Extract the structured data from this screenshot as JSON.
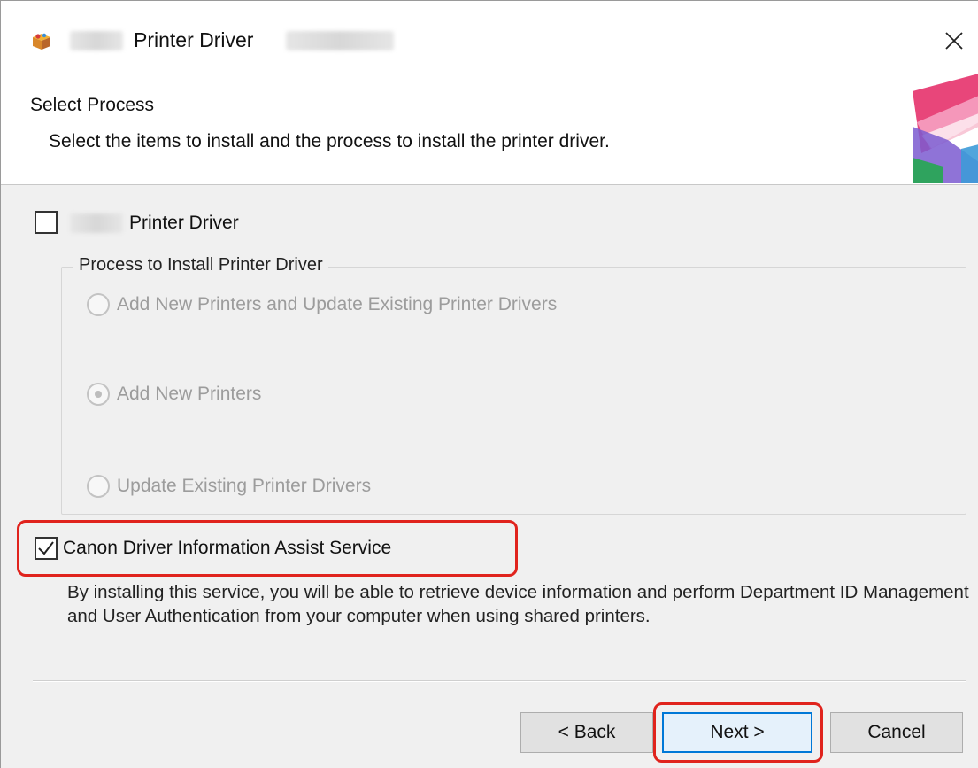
{
  "window": {
    "title": "Printer Driver",
    "close_icon": "close-icon"
  },
  "header": {
    "title": "Select Process",
    "description": "Select the items to install and the process to install the printer driver."
  },
  "driver_option": {
    "label": "Printer Driver",
    "checked": false
  },
  "install_group": {
    "legend": "Process to Install Printer Driver",
    "options": [
      {
        "label": "Add New Printers and Update Existing Printer Drivers",
        "selected": false,
        "enabled": false
      },
      {
        "label": "Add New Printers",
        "selected": true,
        "enabled": false
      },
      {
        "label": "Update Existing Printer Drivers",
        "selected": false,
        "enabled": false
      }
    ]
  },
  "service_option": {
    "label": "Canon Driver Information Assist Service",
    "checked": true,
    "description": "By installing this service, you will be able to retrieve device information and perform Department ID Management and User Authentication from your computer when using shared printers."
  },
  "buttons": {
    "back": "< Back",
    "next": "Next >",
    "cancel": "Cancel"
  },
  "colors": {
    "highlight": "#e0231d",
    "default_button_border": "#0078d7"
  }
}
